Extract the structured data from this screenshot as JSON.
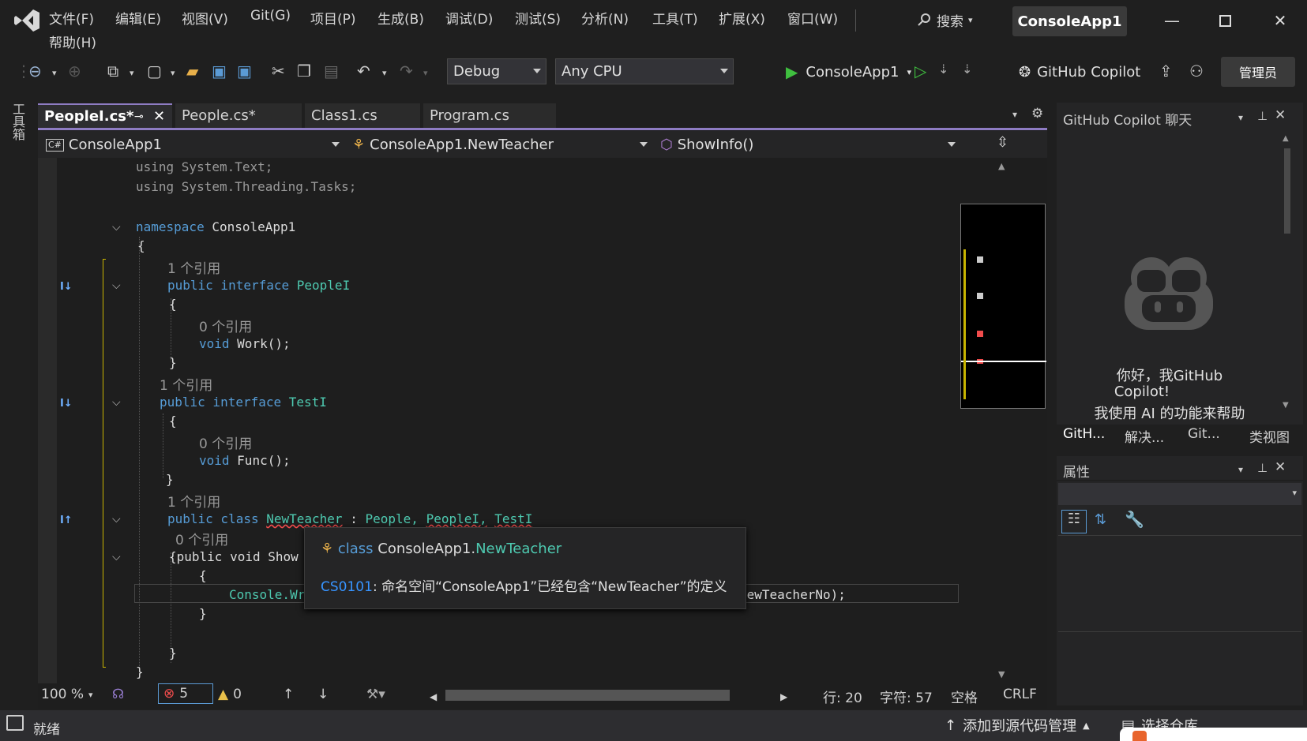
{
  "menu": {
    "items": [
      "文件(F)",
      "编辑(E)",
      "视图(V)",
      "Git(G)",
      "项目(P)",
      "生成(B)",
      "调试(D)",
      "测试(S)",
      "分析(N)",
      "工具(T)",
      "扩展(X)",
      "窗口(W)"
    ],
    "help": "帮助(H)",
    "search": "搜索",
    "app_title": "ConsoleApp1"
  },
  "toolbar": {
    "config": "Debug",
    "platform": "Any CPU",
    "run_target": "ConsoleApp1",
    "copilot": "GitHub Copilot",
    "admin": "管理员"
  },
  "sidebar": {
    "toolbox": "工具箱"
  },
  "tabs": [
    {
      "label": "PeopleI.cs*"
    },
    {
      "label": "People.cs*"
    },
    {
      "label": "Class1.cs"
    },
    {
      "label": "Program.cs"
    }
  ],
  "nav": {
    "project": "ConsoleApp1",
    "type": "ConsoleApp1.NewTeacher",
    "member": "ShowInfo()"
  },
  "code": {
    "l1": "using System.Text;",
    "l2": "using System.Threading.Tasks;",
    "ns_kw": "namespace",
    "ns_name": "ConsoleApp1",
    "brace_open": "{",
    "brace_close": "}",
    "ref1": "1 个引用",
    "ref0": "0 个引用",
    "public_interface": "public interface",
    "peoplei": "PeopleI",
    "void": "void",
    "work": "Work();",
    "testi": "TestI",
    "func": "Func();",
    "public_class": "public class",
    "newteacher": "NewTeacher",
    "colon": ":",
    "people": "People,",
    "peoplei_c": "PeopleI,",
    "testi_c": "TestI",
    "showinfo_line": "{public void Show",
    "console": "Console.Wr",
    "line_end": "NewTeacherNo);"
  },
  "tooltip": {
    "kw": "class",
    "ns": "ConsoleApp1.",
    "type": "NewTeacher",
    "code": "CS0101",
    "message": ": 命名空间“ConsoleApp1”已经包含“NewTeacher”的定义"
  },
  "status": {
    "zoom": "100 %",
    "errors": "5",
    "warnings": "0",
    "line": "行: 20",
    "char": "字符: 57",
    "space": "空格",
    "eol": "CRLF"
  },
  "bottom": {
    "ready": "就绪",
    "source_control": "添加到源代码管理",
    "select_repo": "选择仓库"
  },
  "copilot_panel": {
    "title": "GitHub Copilot 聊天",
    "line1": "你好，我GitHub",
    "line2": "Copilot!",
    "line3": "我使用 AI 的功能来帮助",
    "tabs": [
      "GitH...",
      "解决...",
      "Git...",
      "类视图"
    ]
  },
  "properties": {
    "title": "属性"
  },
  "colors": {
    "accent": "#8e7cc3",
    "error": "#f14c4c",
    "keyword": "#569cd6",
    "type": "#4ec9b0"
  }
}
